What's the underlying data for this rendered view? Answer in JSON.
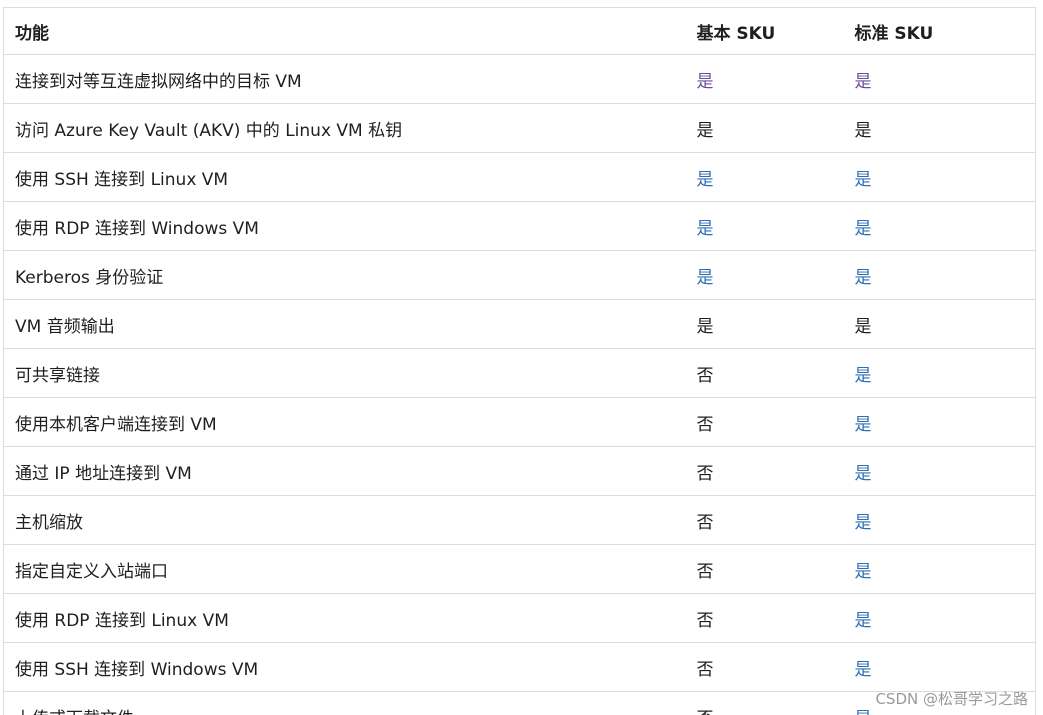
{
  "table": {
    "headers": [
      "功能",
      "基本 SKU",
      "标准 SKU"
    ],
    "rows": [
      {
        "feature": "连接到对等互连虚拟网络中的目标 VM",
        "basic": "是",
        "basic_style": "link-visited",
        "standard": "是",
        "standard_style": "link-visited"
      },
      {
        "feature": "访问 Azure Key Vault (AKV) 中的 Linux VM 私钥",
        "basic": "是",
        "basic_style": "plain",
        "standard": "是",
        "standard_style": "plain"
      },
      {
        "feature": "使用 SSH 连接到 Linux VM",
        "basic": "是",
        "basic_style": "link",
        "standard": "是",
        "standard_style": "link"
      },
      {
        "feature": "使用 RDP 连接到 Windows VM",
        "basic": "是",
        "basic_style": "link",
        "standard": "是",
        "standard_style": "link"
      },
      {
        "feature": "Kerberos 身份验证",
        "basic": "是",
        "basic_style": "link",
        "standard": "是",
        "standard_style": "link"
      },
      {
        "feature": "VM 音频输出",
        "basic": "是",
        "basic_style": "plain",
        "standard": "是",
        "standard_style": "plain"
      },
      {
        "feature": "可共享链接",
        "basic": "否",
        "basic_style": "plain",
        "standard": "是",
        "standard_style": "link"
      },
      {
        "feature": "使用本机客户端连接到 VM",
        "basic": "否",
        "basic_style": "plain",
        "standard": "是",
        "standard_style": "link"
      },
      {
        "feature": "通过 IP 地址连接到 VM",
        "basic": "否",
        "basic_style": "plain",
        "standard": "是",
        "standard_style": "link"
      },
      {
        "feature": "主机缩放",
        "basic": "否",
        "basic_style": "plain",
        "standard": "是",
        "standard_style": "link"
      },
      {
        "feature": "指定自定义入站端口",
        "basic": "否",
        "basic_style": "plain",
        "standard": "是",
        "standard_style": "link"
      },
      {
        "feature": "使用 RDP 连接到 Linux VM",
        "basic": "否",
        "basic_style": "plain",
        "standard": "是",
        "standard_style": "link"
      },
      {
        "feature": "使用 SSH 连接到 Windows VM",
        "basic": "否",
        "basic_style": "plain",
        "standard": "是",
        "standard_style": "link"
      },
      {
        "feature": "上传或下载文件",
        "basic": "否",
        "basic_style": "plain",
        "standard": "是",
        "standard_style": "link"
      }
    ]
  },
  "watermark": "CSDN @松哥学习之路",
  "colors": {
    "link": "#2c6db5",
    "link_visited": "#6b4c9a",
    "text": "#1f1f1f",
    "border": "#dcdcdc"
  }
}
